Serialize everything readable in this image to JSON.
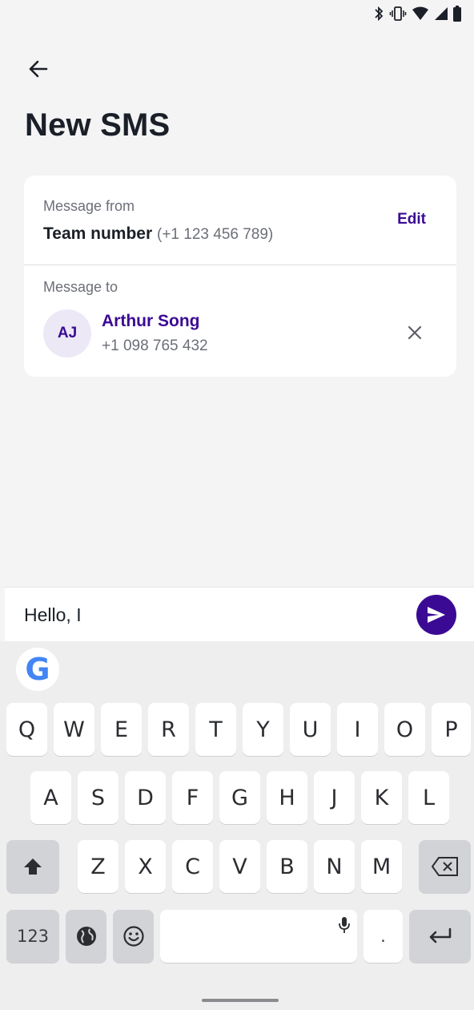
{
  "header": {
    "title": "New SMS"
  },
  "message_from": {
    "label": "Message from",
    "name": "Team number",
    "number": "(+1 123 456 789)",
    "edit_label": "Edit"
  },
  "message_to": {
    "label": "Message to",
    "recipient": {
      "initials": "AJ",
      "name": "Arthur Song",
      "number": "+1 098 765 432"
    }
  },
  "composer": {
    "value": "Hello, I"
  },
  "keyboard": {
    "row1": [
      "Q",
      "W",
      "E",
      "R",
      "T",
      "Y",
      "U",
      "I",
      "O",
      "P"
    ],
    "row2": [
      "A",
      "S",
      "D",
      "F",
      "G",
      "H",
      "J",
      "K",
      "L"
    ],
    "row3": [
      "Z",
      "X",
      "C",
      "V",
      "B",
      "N",
      "M"
    ],
    "numbers_label": "123",
    "period_label": ".",
    "g_label": "G"
  },
  "colors": {
    "accent": "#3b0a94",
    "background": "#f4f4f5"
  },
  "icons": {
    "back": "arrow-left-icon",
    "close": "close-icon",
    "send": "send-icon",
    "shift": "shift-icon",
    "backspace": "backspace-icon",
    "globe": "globe-icon",
    "emoji": "emoji-icon",
    "mic": "mic-icon",
    "enter": "enter-icon"
  }
}
